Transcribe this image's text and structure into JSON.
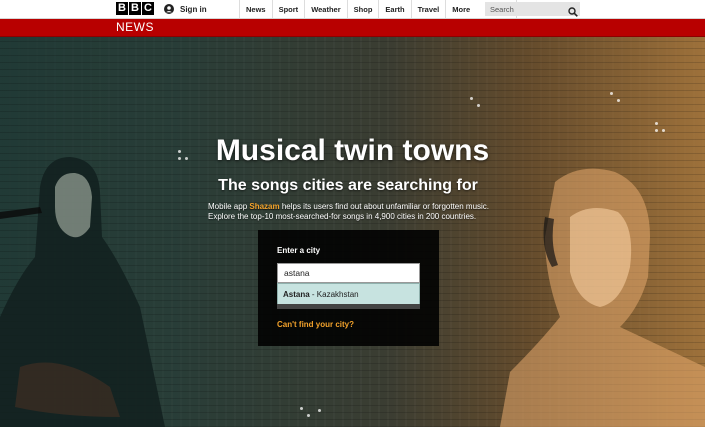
{
  "header": {
    "logo": [
      "B",
      "B",
      "C"
    ],
    "signin_label": "Sign in",
    "nav": [
      "News",
      "Sport",
      "Weather",
      "Shop",
      "Earth",
      "Travel"
    ],
    "more_label": "More",
    "search_placeholder": "Search"
  },
  "news_bar": {
    "brand": "NEWS"
  },
  "hero": {
    "headline": "Musical twin towns",
    "subheadline": "The songs cities are searching for",
    "intro_prefix": "Mobile app ",
    "intro_brand": "Shazam",
    "intro_rest": " helps its users find out about unfamiliar or forgotten music. Explore the top-10 most-searched-for songs in 4,900 cities in 200 countries."
  },
  "city_finder": {
    "label": "Enter a city",
    "value": "astana",
    "suggestions": [
      {
        "city": "Astana",
        "separator": " - ",
        "country": "Kazakhstan"
      }
    ],
    "cant_find": "Can't find your city?"
  },
  "colors": {
    "news_red": "#b80000",
    "accent_orange": "#f3a22b",
    "suggestion_bg": "#c7e3e0"
  }
}
